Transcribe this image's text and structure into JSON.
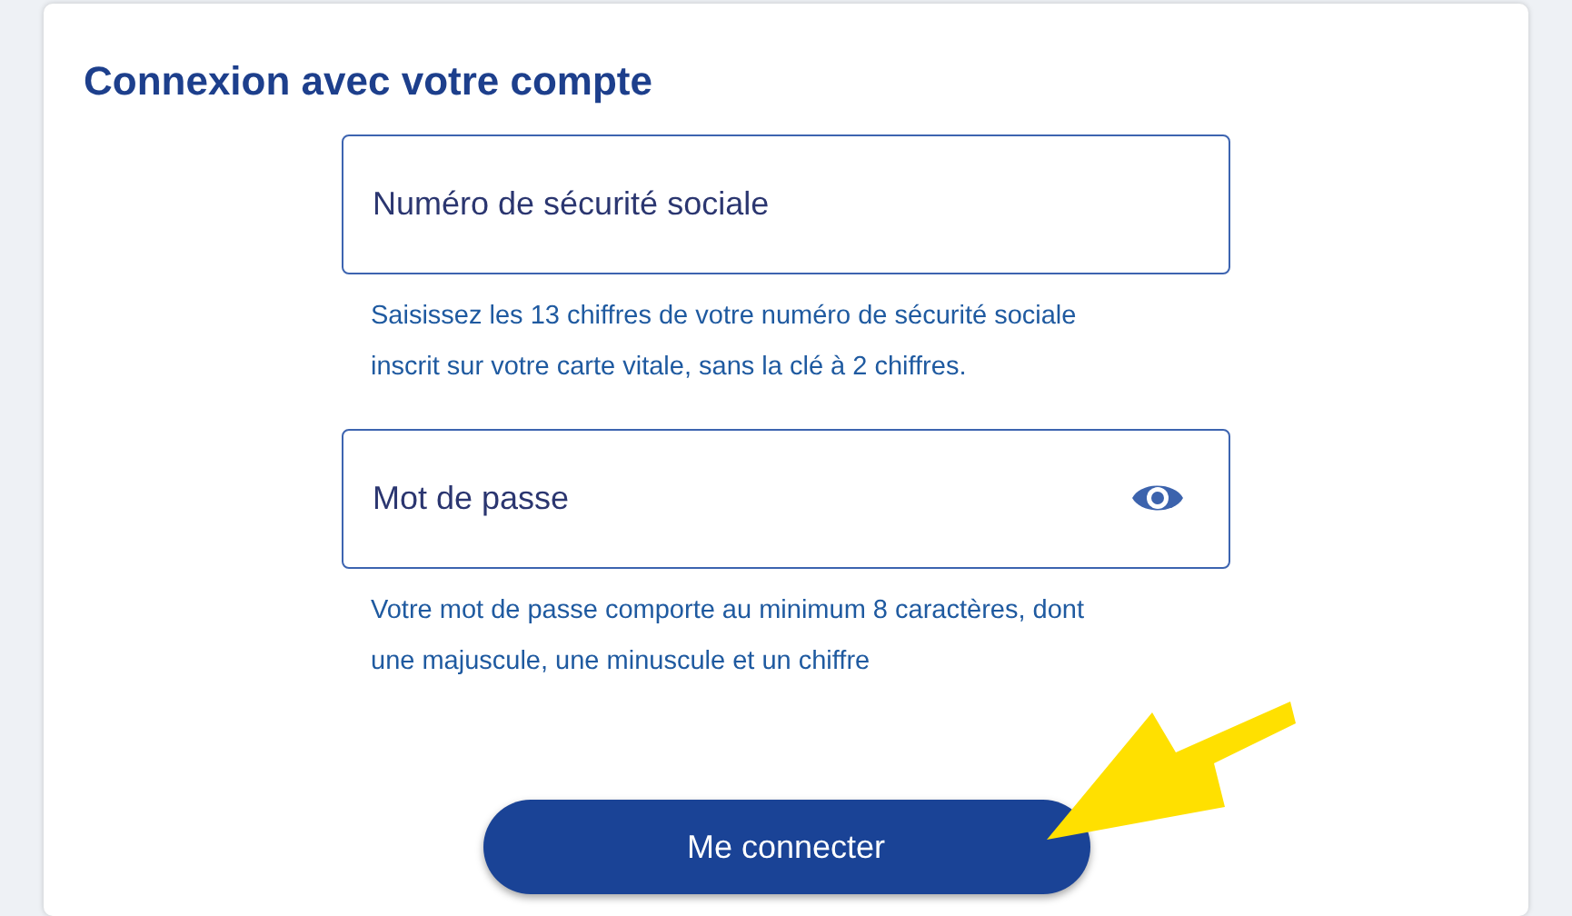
{
  "title": "Connexion avec votre compte",
  "fields": [
    {
      "kind": "text",
      "placeholder": "Numéro de sécurité sociale",
      "hint": "Saisissez les 13 chiffres de votre numéro de sécurité sociale inscrit sur votre carte vitale, sans la clé à 2 chiffres."
    },
    {
      "kind": "password",
      "placeholder": "Mot de passe",
      "hint": "Votre mot de passe comporte au minimum 8 caractères, dont une majuscule, une minuscule et un chiffre"
    }
  ],
  "submit": {
    "label": "Me connecter"
  }
}
